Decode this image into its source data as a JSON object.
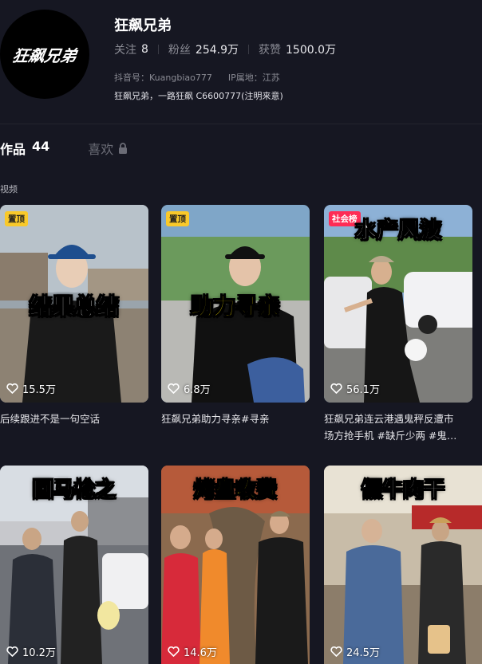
{
  "profile": {
    "avatar_text": "狂飙兄弟",
    "name": "狂飙兄弟",
    "following_label": "关注",
    "following_value": "8",
    "followers_label": "粉丝",
    "followers_value": "254.9万",
    "likes_label": "获赞",
    "likes_value": "1500.0万",
    "douyin_id": "抖音号：Kuangbiao777",
    "ip_location": "IP属地：江苏",
    "bio": "狂飙兄弟，一路狂飙 C6600777(注明来意)"
  },
  "tabs": {
    "works_label": "作品",
    "works_count": "44",
    "likes_tab_label": "喜欢"
  },
  "section_label": "视频",
  "videos": [
    {
      "badge": "置顶",
      "overlay": "结果总结",
      "likes": "15.5万",
      "caption": "后续跟进不是一句空话"
    },
    {
      "badge": "置顶",
      "overlay": "助力寻亲",
      "likes": "6.8万",
      "caption": "狂飙兄弟助力寻亲#寻亲"
    },
    {
      "badge": "社会榜",
      "overlay": "水产风波",
      "likes": "56.1万",
      "caption_line1": "狂飙兄弟连云港遇鬼秤反遭市",
      "caption_line2": "场方抢手机 #缺斤少两 #鬼…"
    },
    {
      "badge": "",
      "overlay": "回马枪之",
      "likes": "10.2万",
      "caption": ""
    },
    {
      "badge": "",
      "overlay": "烤盘收费",
      "likes": "14.6万",
      "caption": ""
    },
    {
      "badge": "",
      "overlay": "假牛肉干",
      "likes": "24.5万",
      "caption": ""
    }
  ],
  "colors": {
    "background": "#161722",
    "pin_badge": "#f9c92a",
    "hot_badge": "#fe2c55"
  }
}
